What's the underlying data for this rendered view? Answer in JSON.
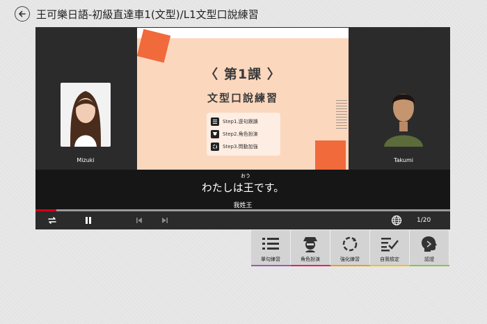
{
  "header": {
    "title": "王可樂日語-初級直達車1(文型)/L1文型口說練習",
    "back_icon": "back-arrow-icon"
  },
  "speakers": {
    "left_name": "Mizuki",
    "right_name": "Takumi"
  },
  "slide": {
    "heading": "〈 第1課 〉",
    "subtitle": "文型口說練習",
    "steps": [
      {
        "label": "Step1.逐句跟讀",
        "icon": "list-icon"
      },
      {
        "label": "Step2.角色扮演",
        "icon": "role-icon"
      },
      {
        "label": "Step3.問動加強",
        "icon": "refresh-icon"
      }
    ],
    "accent_color": "#f06a3c",
    "background_color": "#fbd7be"
  },
  "subtitle": {
    "furigana": "おう",
    "japanese": "わたしは王です。",
    "chinese": "我姓王"
  },
  "player": {
    "page_indicator": "1/20",
    "progress_fraction": 0.05,
    "progress_color": "#d0021b",
    "icons": {
      "repeat": "repeat-icon",
      "pause": "pause-icon",
      "prev": "skip-previous-icon",
      "next": "skip-next-icon",
      "language": "globe-icon"
    }
  },
  "modes": [
    {
      "label": "單句練習",
      "icon": "list-icon",
      "color": "#9b59b6"
    },
    {
      "label": "角色扮演",
      "icon": "role-play-icon",
      "color": "#e91e63"
    },
    {
      "label": "強化練習",
      "icon": "refresh-icon",
      "color": "#f39c12"
    },
    {
      "label": "自我檢定",
      "icon": "checklist-icon",
      "color": "#f1c40f"
    },
    {
      "label": "認證",
      "icon": "speaking-head-icon",
      "color": "#8bc34a"
    }
  ]
}
